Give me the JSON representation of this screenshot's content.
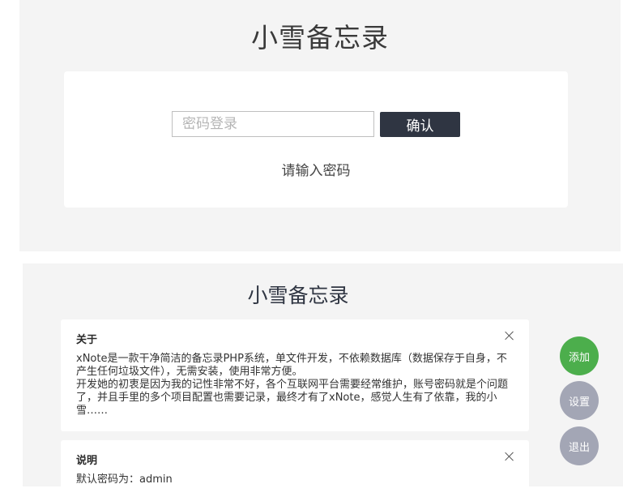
{
  "login": {
    "title": "小雪备忘录",
    "password_placeholder": "密码登录",
    "password_value": "",
    "confirm_label": "确认",
    "hint": "请输入密码"
  },
  "notes": {
    "title": "小雪备忘录",
    "items": [
      {
        "title": "关于",
        "body": "xNote是一款干净简洁的备忘录PHP系统，单文件开发，不依赖数据库（数据保存于自身，不产生任何垃圾文件），无需安装，使用非常方便。\n开发她的初衷是因为我的记性非常不好，各个互联网平台需要经常维护，账号密码就是个问题了，并且手里的多个项目配置也需要记录，最终才有了xNote，感觉人生有了依靠，我的小雪……"
      },
      {
        "title": "说明",
        "body": "默认密码为：admin"
      }
    ],
    "actions": {
      "add_label": "添加",
      "settings_label": "设置",
      "logout_label": "退出"
    }
  },
  "colors": {
    "panel_bg": "#f4f4f4",
    "primary_button": "#2f3542",
    "add_button": "#4cae4c",
    "secondary_button": "#a3a6b5"
  },
  "icons": {
    "close": "close-icon"
  }
}
